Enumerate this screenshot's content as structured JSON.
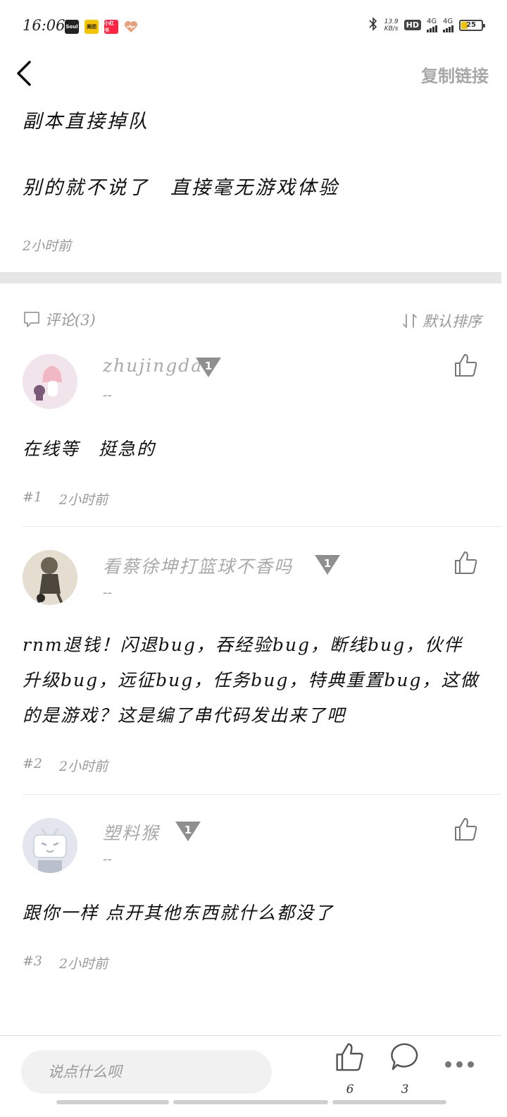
{
  "status_bar": {
    "time": "16:06",
    "apps": [
      {
        "label": "Soul",
        "color": "#222222"
      },
      {
        "label": "美团",
        "color": "#f5c400"
      },
      {
        "label": "小红书",
        "color": "#ff2442"
      },
      {
        "label": "",
        "color": "#ffffff"
      }
    ],
    "net_speed_value": "13.9",
    "net_speed_unit": "KB/s",
    "hd": "HD",
    "signal1": "4G",
    "signal2": "4G",
    "battery": "25"
  },
  "header": {
    "copy_link": "复制链接"
  },
  "post": {
    "line1": "副本直接掉队",
    "line2": "别的就不说了　直接毫无游戏体验",
    "time": "2小时前"
  },
  "comments_section": {
    "title": "评论(3)",
    "sort_label": "默认排序"
  },
  "comments": [
    {
      "username": "zhujingda",
      "level": "1",
      "sub": "--",
      "text": "在线等　挺急的",
      "floor": "#1",
      "time": "2小时前"
    },
    {
      "username": "看蔡徐坤打篮球不香吗",
      "level": "1",
      "sub": "--",
      "text": "rnm退钱！闪退bug，吞经验bug，断线bug，伙伴升级bug，远征bug，任务bug，特典重置bug，这做的是游戏？这是编了串代码发出来了吧",
      "floor": "#2",
      "time": "2小时前"
    },
    {
      "username": "塑料猴",
      "level": "1",
      "sub": "--",
      "text": "跟你一样 点开其他东西就什么都没了",
      "floor": "#3",
      "time": "2小时前"
    }
  ],
  "bottom_bar": {
    "placeholder": "说点什么呗",
    "like_count": "6",
    "comment_count": "3"
  }
}
